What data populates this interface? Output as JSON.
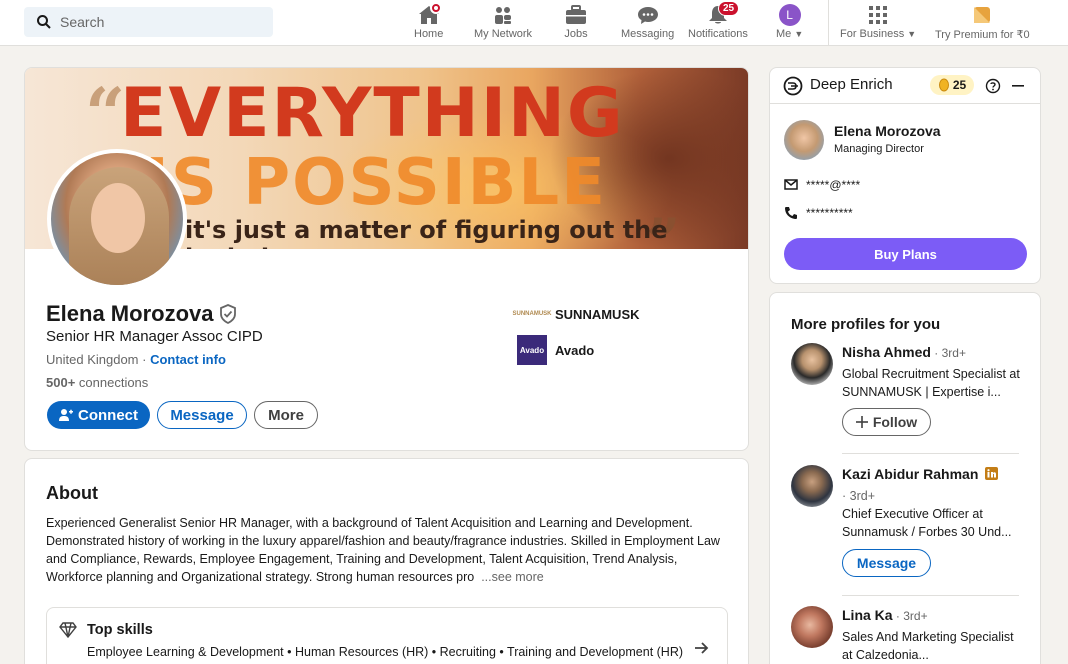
{
  "nav": {
    "search_placeholder": "Search",
    "items": [
      {
        "label": "Home"
      },
      {
        "label": "My Network"
      },
      {
        "label": "Jobs"
      },
      {
        "label": "Messaging"
      },
      {
        "label": "Notifications",
        "badge": "25"
      },
      {
        "label": "Me",
        "avatar_letter": "L"
      },
      {
        "label": "For Business"
      },
      {
        "label": "Try Premium for ₹0"
      }
    ]
  },
  "banner": {
    "quote_open": "“",
    "line1": "EVERYTHING",
    "line2": "IS POSSIBLE",
    "quote_close": "„",
    "line3": "it's just a matter of figuring out the logistics."
  },
  "profile": {
    "name": "Elena Morozova",
    "headline": "Senior HR Manager Assoc CIPD",
    "location": "United Kingdom",
    "location_sep": " · ",
    "contact_info": "Contact info",
    "connections_count": "500+",
    "connections_label": " connections",
    "buttons": {
      "connect": "Connect",
      "message": "Message",
      "more": "More"
    },
    "companies": [
      {
        "name": "SUNNAMUSK",
        "logo_text": "SUNNAMUSK"
      },
      {
        "name": "Avado",
        "logo_text": "Avado"
      }
    ]
  },
  "about": {
    "title": "About",
    "text": "Experienced Generalist Senior HR Manager, with a background of Talent Acquisition and Learning and Development. Demonstrated history of working in the luxury apparel/fashion and beauty/fragrance industries. Skilled in Employment Law and Compliance, Rewards, Employee Engagement, Training and Development, Talent Acquisition, Trend Analysis, Workforce planning and Organizational strategy. Strong human resources pro",
    "see_more": "...see more",
    "top_skills_title": "Top skills",
    "top_skills": "Employee Learning & Development • Human Resources (HR) • Recruiting • Training and Development (HR) • Talent Management"
  },
  "deep_enrich": {
    "title": "Deep Enrich",
    "credits": "25",
    "person_name": "Elena Morozova",
    "person_title": "Managing Director",
    "email": "*****@****",
    "phone": "**********",
    "buy_plans": "Buy Plans"
  },
  "more_profiles": {
    "title": "More profiles for you",
    "items": [
      {
        "name": "Nisha Ahmed",
        "degree": " · 3rd+",
        "headline": "Global Recruitment Specialist at SUNNAMUSK | Expertise i...",
        "action": "Follow"
      },
      {
        "name": "Kazi Abidur Rahman",
        "degree": "· 3rd+",
        "headline": "Chief Executive Officer at Sunnamusk / Forbes 30 Und...",
        "action": "Message"
      },
      {
        "name": "Lina Ka",
        "degree": " · 3rd+",
        "headline": "Sales And Marketing Specialist at Calzedonia..."
      }
    ]
  },
  "colors": {
    "brand_blue": "#0a66c2",
    "deep_enrich_purple": "#7c5cf6",
    "notification_red": "#cb112d"
  }
}
